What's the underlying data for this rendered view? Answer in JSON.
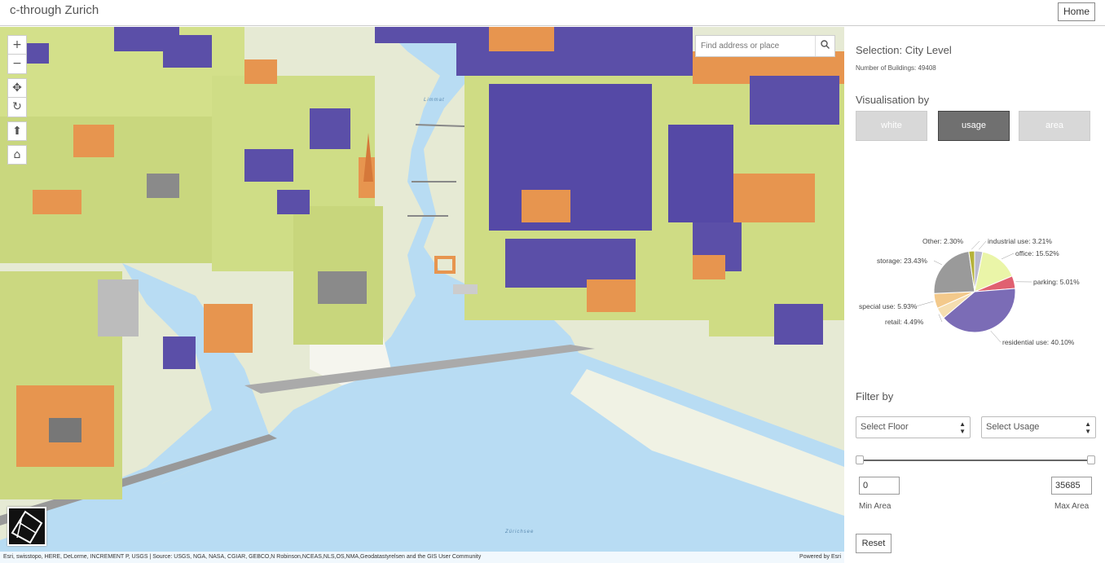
{
  "header": {
    "title": "c-through Zurich",
    "home_label": "Home"
  },
  "map": {
    "search_placeholder": "Find address or place",
    "controls": {
      "zoom_in": "+",
      "zoom_out": "−",
      "pan": "✥",
      "rotate": "↻",
      "compass": "⬆",
      "home": "⌂"
    },
    "attribution": "Esri, swisstopo, HERE, DeLorme, INCREMENT P, USGS | Source: USGS, NGA, NASA, CGIAR, GEBCO,N Robinson,NCEAS,NLS,OS,NMA,Geodatastyrelsen and the GIS User Community",
    "powered_by": "Powered by Esri",
    "water_label": "Zürichsee"
  },
  "panel": {
    "selection_title": "Selection: City Level",
    "buildings_count": "Number of Buildings: 49408",
    "visualisation_title": "Visualisation by",
    "vis_buttons": [
      {
        "label": "white",
        "active": false
      },
      {
        "label": "usage",
        "active": true
      },
      {
        "label": "area",
        "active": false
      }
    ],
    "filter_title": "Filter by",
    "select_floor": "Select Floor",
    "select_usage": "Select Usage",
    "min_area_value": "0",
    "max_area_value": "35685",
    "min_area_label": "Min Area",
    "max_area_label": "Max Area",
    "reset_label": "Reset"
  },
  "colors": {
    "residential": "#7b6cb6",
    "office": "#eaf5a8",
    "industrial": "#b9b9ce",
    "other": "#b5b23a",
    "storage": "#9a9a9a",
    "special": "#f3c98b",
    "retail": "#f5deb0",
    "parking": "#e06070",
    "water": "#b8dcf3"
  },
  "chart_data": {
    "type": "pie",
    "slices": [
      {
        "label": "industrial use: 3.21%",
        "value": 3.21,
        "color": "#b9b9ce"
      },
      {
        "label": "office: 15.52%",
        "value": 15.52,
        "color": "#eaf5a8"
      },
      {
        "label": "parking: 5.01%",
        "value": 5.01,
        "color": "#e06070"
      },
      {
        "label": "residential use: 40.10%",
        "value": 40.1,
        "color": "#7b6cb6"
      },
      {
        "label": "retail: 4.49%",
        "value": 4.49,
        "color": "#f5deb0"
      },
      {
        "label": "special use: 5.93%",
        "value": 5.93,
        "color": "#f3c98b"
      },
      {
        "label": "storage: 23.43%",
        "value": 23.43,
        "color": "#9a9a9a"
      },
      {
        "label": "Other: 2.30%",
        "value": 2.3,
        "color": "#b5b23a"
      }
    ]
  }
}
